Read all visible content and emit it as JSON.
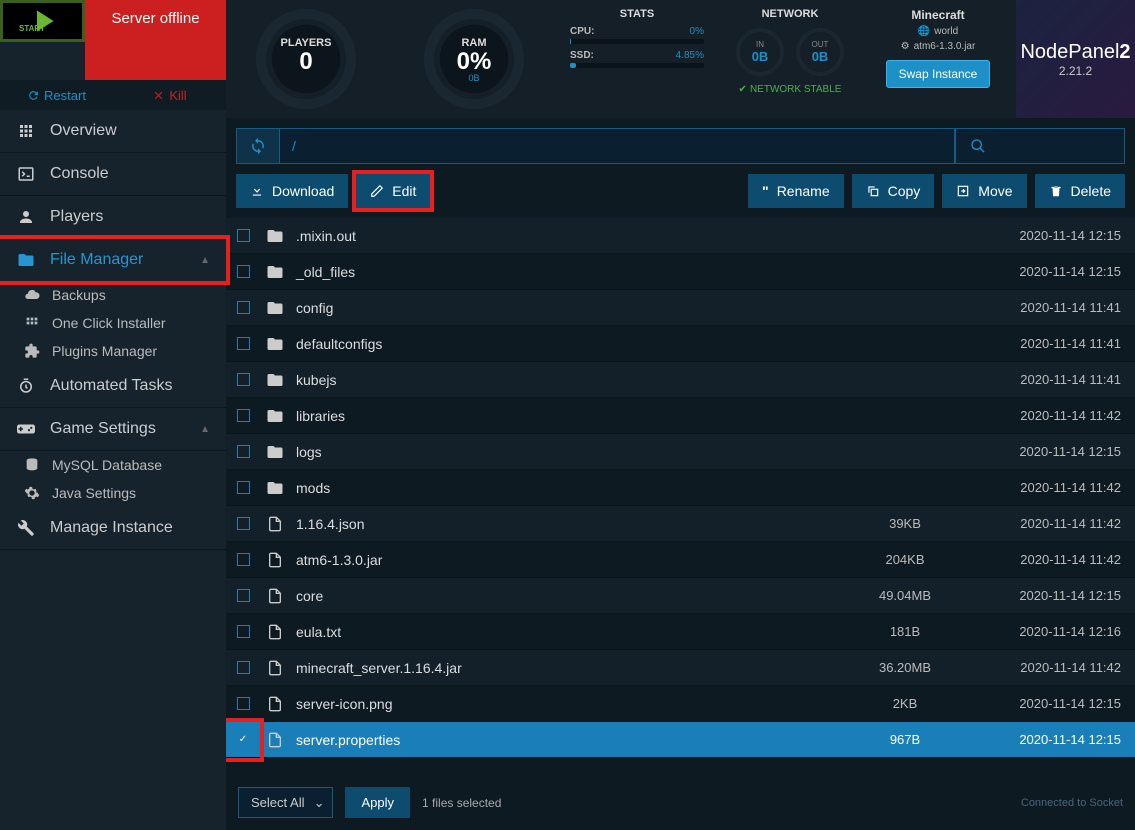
{
  "status": {
    "start_label": "START",
    "offline_text": "Server offline",
    "restart_label": "Restart",
    "kill_label": "Kill"
  },
  "header": {
    "players": {
      "label": "PLAYERS",
      "value": "0"
    },
    "ram": {
      "label": "RAM",
      "value": "0%",
      "sub": "0B"
    },
    "stats": {
      "title": "STATS",
      "cpu_label": "CPU:",
      "cpu_val": "0%",
      "ssd_label": "SSD:",
      "ssd_val": "4.85%"
    },
    "network": {
      "title": "NETWORK",
      "in_label": "IN",
      "in_val": "0B",
      "out_label": "OUT",
      "out_val": "0B",
      "stable": "NETWORK STABLE"
    },
    "swap": {
      "title": "Minecraft",
      "world": "world",
      "jar": "atm6-1.3.0.jar",
      "button": "Swap Instance"
    },
    "brand": {
      "name": "NodePanel",
      "suffix": "2",
      "version": "2.21.2"
    }
  },
  "nav": {
    "overview": "Overview",
    "console": "Console",
    "players": "Players",
    "file_manager": "File Manager",
    "backups": "Backups",
    "one_click": "One Click Installer",
    "plugins": "Plugins Manager",
    "automated": "Automated Tasks",
    "game_settings": "Game Settings",
    "mysql": "MySQL Database",
    "java": "Java Settings",
    "manage": "Manage Instance"
  },
  "path": "/",
  "toolbar": {
    "download": "Download",
    "edit": "Edit",
    "rename": "Rename",
    "copy": "Copy",
    "move": "Move",
    "delete": "Delete"
  },
  "files": [
    {
      "type": "folder",
      "name": ".mixin.out",
      "size": "",
      "date": "2020-11-14 12:15",
      "checked": false
    },
    {
      "type": "folder",
      "name": "_old_files",
      "size": "",
      "date": "2020-11-14 12:15",
      "checked": false
    },
    {
      "type": "folder",
      "name": "config",
      "size": "",
      "date": "2020-11-14 11:41",
      "checked": false
    },
    {
      "type": "folder",
      "name": "defaultconfigs",
      "size": "",
      "date": "2020-11-14 11:41",
      "checked": false
    },
    {
      "type": "folder",
      "name": "kubejs",
      "size": "",
      "date": "2020-11-14 11:41",
      "checked": false
    },
    {
      "type": "folder",
      "name": "libraries",
      "size": "",
      "date": "2020-11-14 11:42",
      "checked": false
    },
    {
      "type": "folder",
      "name": "logs",
      "size": "",
      "date": "2020-11-14 12:15",
      "checked": false
    },
    {
      "type": "folder",
      "name": "mods",
      "size": "",
      "date": "2020-11-14 11:42",
      "checked": false
    },
    {
      "type": "file",
      "name": "1.16.4.json",
      "size": "39KB",
      "date": "2020-11-14 11:42",
      "checked": false
    },
    {
      "type": "file",
      "name": "atm6-1.3.0.jar",
      "size": "204KB",
      "date": "2020-11-14 11:42",
      "checked": false
    },
    {
      "type": "file",
      "name": "core",
      "size": "49.04MB",
      "date": "2020-11-14 12:15",
      "checked": false
    },
    {
      "type": "file",
      "name": "eula.txt",
      "size": "181B",
      "date": "2020-11-14 12:16",
      "checked": false
    },
    {
      "type": "file",
      "name": "minecraft_server.1.16.4.jar",
      "size": "36.20MB",
      "date": "2020-11-14 11:42",
      "checked": false
    },
    {
      "type": "file",
      "name": "server-icon.png",
      "size": "2KB",
      "date": "2020-11-14 12:15",
      "checked": false
    },
    {
      "type": "file",
      "name": "server.properties",
      "size": "967B",
      "date": "2020-11-14 12:15",
      "checked": true
    }
  ],
  "footer": {
    "select_all": "Select All",
    "apply": "Apply",
    "selected_text": "1 files selected",
    "socket": "Connected to Socket"
  }
}
